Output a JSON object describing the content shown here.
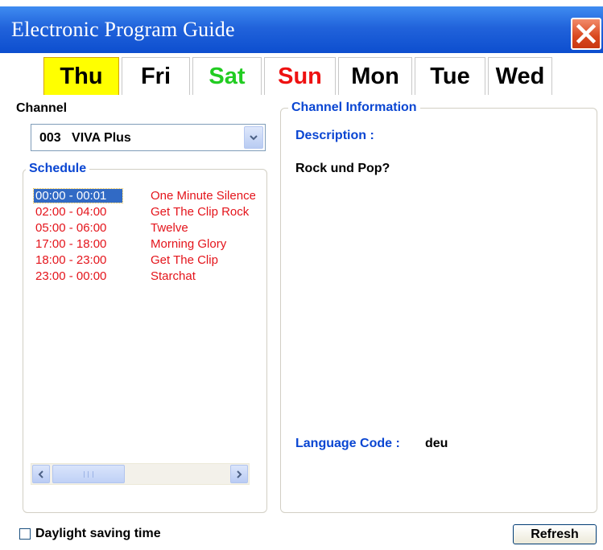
{
  "window": {
    "title": "Electronic Program Guide",
    "close_icon": "close-icon"
  },
  "days": [
    {
      "label": "Thu",
      "color": "#000000",
      "active": true
    },
    {
      "label": "Fri",
      "color": "#000000",
      "active": false
    },
    {
      "label": "Sat",
      "color": "#22cc22",
      "active": false
    },
    {
      "label": "Sun",
      "color": "#ee1111",
      "active": false
    },
    {
      "label": "Mon",
      "color": "#000000",
      "active": false
    },
    {
      "label": "Tue",
      "color": "#000000",
      "active": false
    },
    {
      "label": "Wed",
      "color": "#000000",
      "active": false
    }
  ],
  "channel": {
    "label": "Channel",
    "selected": "003   VIVA Plus"
  },
  "schedule": {
    "label": "Schedule",
    "rows": [
      {
        "time": "00:00 - 00:01",
        "program": "One Minute Silence",
        "selected": true
      },
      {
        "time": "02:00 - 04:00",
        "program": "Get The Clip Rock",
        "selected": false
      },
      {
        "time": "05:00 - 06:00",
        "program": "Twelve",
        "selected": false
      },
      {
        "time": "17:00 - 18:00",
        "program": "Morning Glory",
        "selected": false
      },
      {
        "time": "18:00 - 23:00",
        "program": "Get The Clip",
        "selected": false
      },
      {
        "time": "23:00 - 00:00",
        "program": "Starchat",
        "selected": false
      }
    ]
  },
  "info": {
    "label": "Channel Information",
    "description_label": "Description :",
    "description": "Rock und Pop?",
    "language_label": "Language Code :",
    "language": "deu"
  },
  "footer": {
    "dst_label": "Daylight saving time",
    "dst_checked": false,
    "refresh_label": "Refresh"
  },
  "colors": {
    "title_bar": "#2163db",
    "accent_blue": "#0a46d2",
    "schedule_text": "#e4141b",
    "selection": "#316ac5",
    "active_tab": "#ffff00"
  }
}
